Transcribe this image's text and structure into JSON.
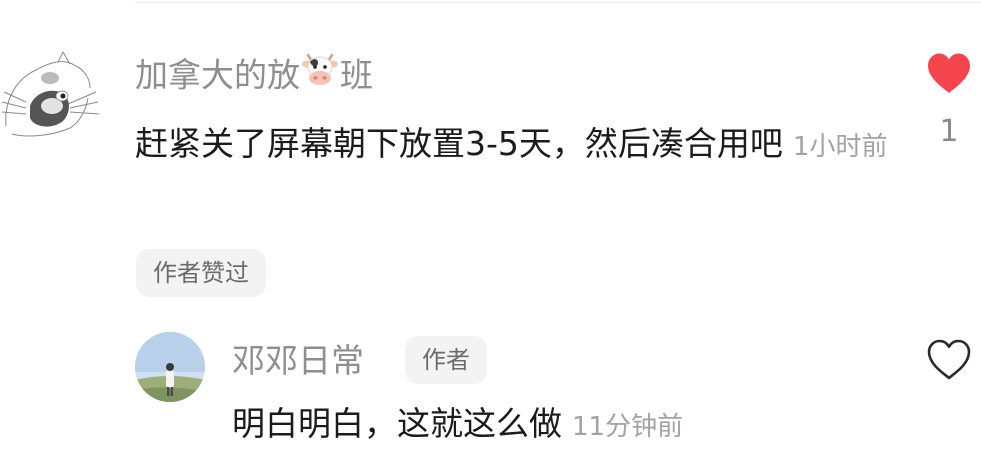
{
  "comment1": {
    "username_part1": "加拿大的放",
    "username_emoji_icon": "cow-face-icon",
    "username_part2": "班",
    "text": "赶紧关了屏幕朝下放置3-5天，然后凑合用吧",
    "time": "1小时前",
    "author_liked_tag": "作者赞过",
    "like_count": "1",
    "like_state": "liked",
    "like_color": "#f5454f"
  },
  "reply1": {
    "username": "邓邓日常",
    "author_badge": "作者",
    "text": "明白明白，这就这么做",
    "time": "11分钟前",
    "like_state": "not-liked"
  }
}
